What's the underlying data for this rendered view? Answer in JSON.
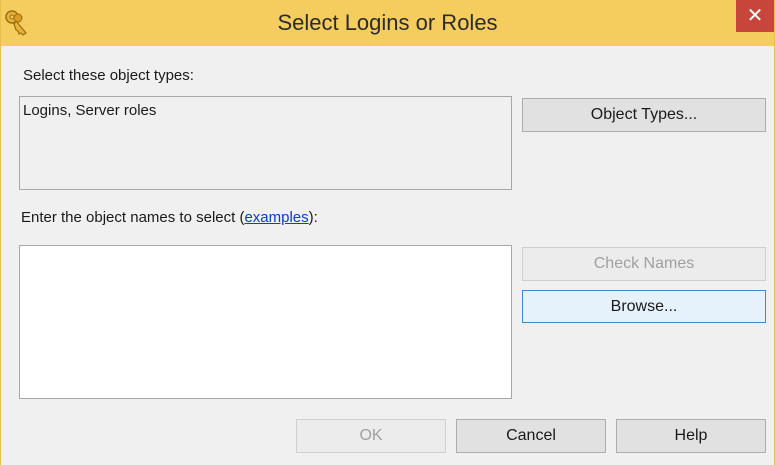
{
  "window": {
    "title": "Select Logins or Roles",
    "icon": "keys-icon",
    "close_glyph": "✕",
    "accent": "#f5cc5e",
    "close_color": "#c7453a"
  },
  "object_types": {
    "label": "Select these object types:",
    "value": "Logins, Server roles",
    "button_label": "Object Types..."
  },
  "object_names": {
    "label_prefix": "Enter the object names to select (",
    "link_text": "examples",
    "label_suffix": "):",
    "value": "",
    "check_names_label": "Check Names",
    "browse_label": "Browse..."
  },
  "footer": {
    "ok_label": "OK",
    "cancel_label": "Cancel",
    "help_label": "Help"
  }
}
